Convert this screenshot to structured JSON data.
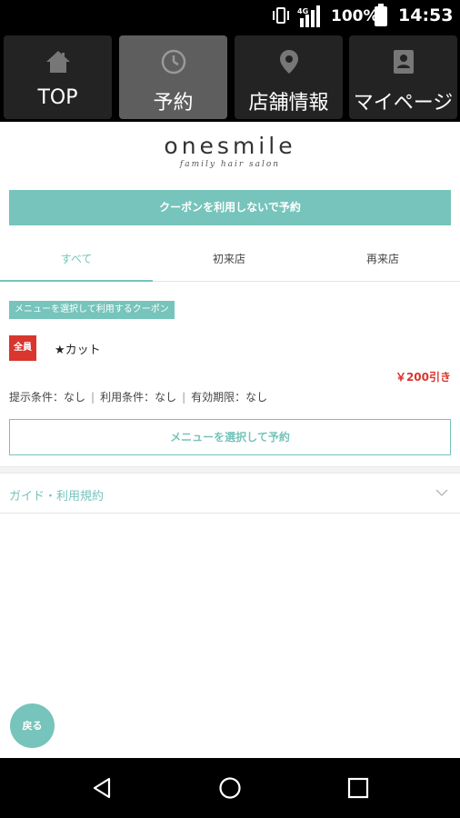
{
  "status_bar": {
    "network": "4G",
    "battery": "100%",
    "time": "14:53"
  },
  "nav_tabs": [
    {
      "label": "TOP",
      "icon": "home-icon",
      "active": false
    },
    {
      "label": "予約",
      "icon": "clock-icon",
      "active": true
    },
    {
      "label": "店舗情報",
      "icon": "location-pin-icon",
      "active": false
    },
    {
      "label": "マイページ",
      "icon": "profile-card-icon",
      "active": false
    }
  ],
  "logo": {
    "main": "onesmile",
    "sub": "family hair salon"
  },
  "buttons": {
    "no_coupon_reserve": "クーポンを利用しないで予約",
    "select_menu_reserve": "メニューを選択して予約",
    "back": "戻る"
  },
  "filter_tabs": [
    {
      "label": "すべて",
      "active": true
    },
    {
      "label": "初来店",
      "active": false
    },
    {
      "label": "再来店",
      "active": false
    }
  ],
  "coupon": {
    "tag": "メニューを選択して利用するクーポン",
    "badge": "全員",
    "name": "★カット",
    "price": "￥200引き",
    "conditions": {
      "present": "提示条件：なし",
      "use": "利用条件：なし",
      "expiry": "有効期限：なし"
    }
  },
  "guide": {
    "label": "ガイド・利用規約"
  },
  "colors": {
    "accent": "#76c4bb",
    "badge_red": "#d8362e",
    "nav_active": "#5e5e5e",
    "nav_inactive": "#232323"
  }
}
